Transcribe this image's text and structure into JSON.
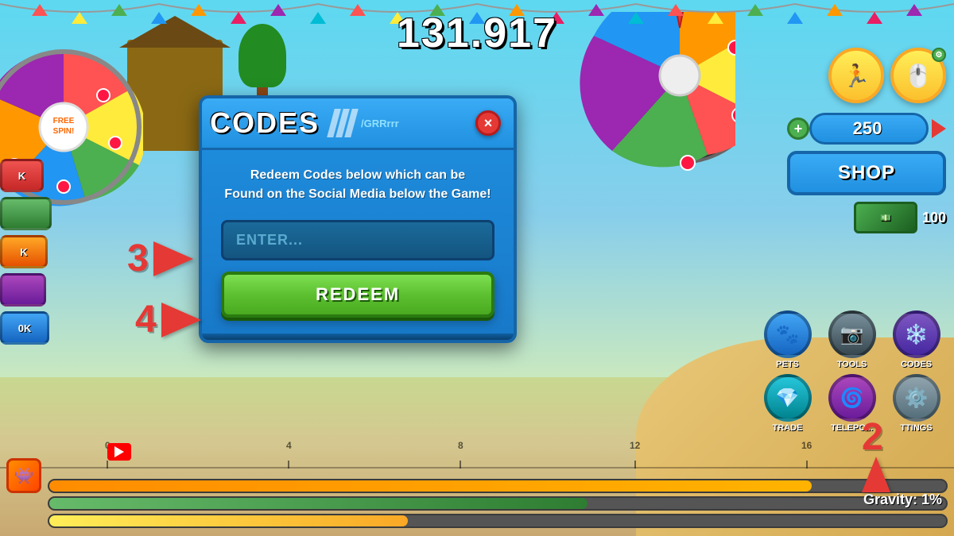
{
  "score": {
    "value": "131.917"
  },
  "modal": {
    "title": "CODES",
    "subtitle": "/GRRrrr",
    "description_line1": "Redeem Codes below which can be",
    "description_line2": "Found on the Social Media below the Game!",
    "input_placeholder": "ENTER...",
    "redeem_label": "REDEEM",
    "close_label": "×"
  },
  "currency": {
    "amount": "250"
  },
  "shop_label": "SHOP",
  "arrows": {
    "arrow3_number": "3",
    "arrow4_number": "4",
    "arrow2_number": "2"
  },
  "bottom_icons": [
    {
      "id": "pets",
      "label": "PETS",
      "icon": "🐾",
      "color": "#2090E0"
    },
    {
      "id": "tools",
      "label": "TOOLS",
      "icon": "📷",
      "color": "#607D8B"
    },
    {
      "id": "codes",
      "label": "CODES",
      "icon": "❄️",
      "color": "#7B68EE"
    },
    {
      "id": "trade",
      "label": "TRADE",
      "icon": "💎",
      "color": "#00BCD4"
    },
    {
      "id": "teleport",
      "label": "TELEPO...",
      "icon": "🌀",
      "color": "#9C27B0"
    },
    {
      "id": "settings",
      "label": "TTINGS",
      "icon": "⚙️",
      "color": "#78909C"
    }
  ],
  "gravity_text": "Gravity: 1%",
  "progress_bars": [
    {
      "color": "#FF8C00",
      "width": "85%"
    },
    {
      "color": "#4CAF50",
      "width": "60%"
    },
    {
      "color": "#FFD700",
      "width": "40%"
    }
  ],
  "ruler_marks": [
    {
      "label": "0",
      "left": "11%"
    },
    {
      "label": "4",
      "left": "30%"
    },
    {
      "label": "8",
      "left": "48%"
    },
    {
      "label": "12",
      "left": "66%"
    },
    {
      "label": "16",
      "left": "84%"
    }
  ],
  "sidebar_buttons": [
    {
      "color": "#E53935"
    },
    {
      "color": "#4CAF50"
    },
    {
      "color": "#FF9800"
    },
    {
      "color": "#9C27B0"
    },
    {
      "color": "#2196F3"
    }
  ],
  "wheel_left": {
    "free_spin": "FREE\nSPIN!"
  },
  "icons": {
    "close": "×",
    "plus": "+",
    "arrow_right": "▶"
  }
}
